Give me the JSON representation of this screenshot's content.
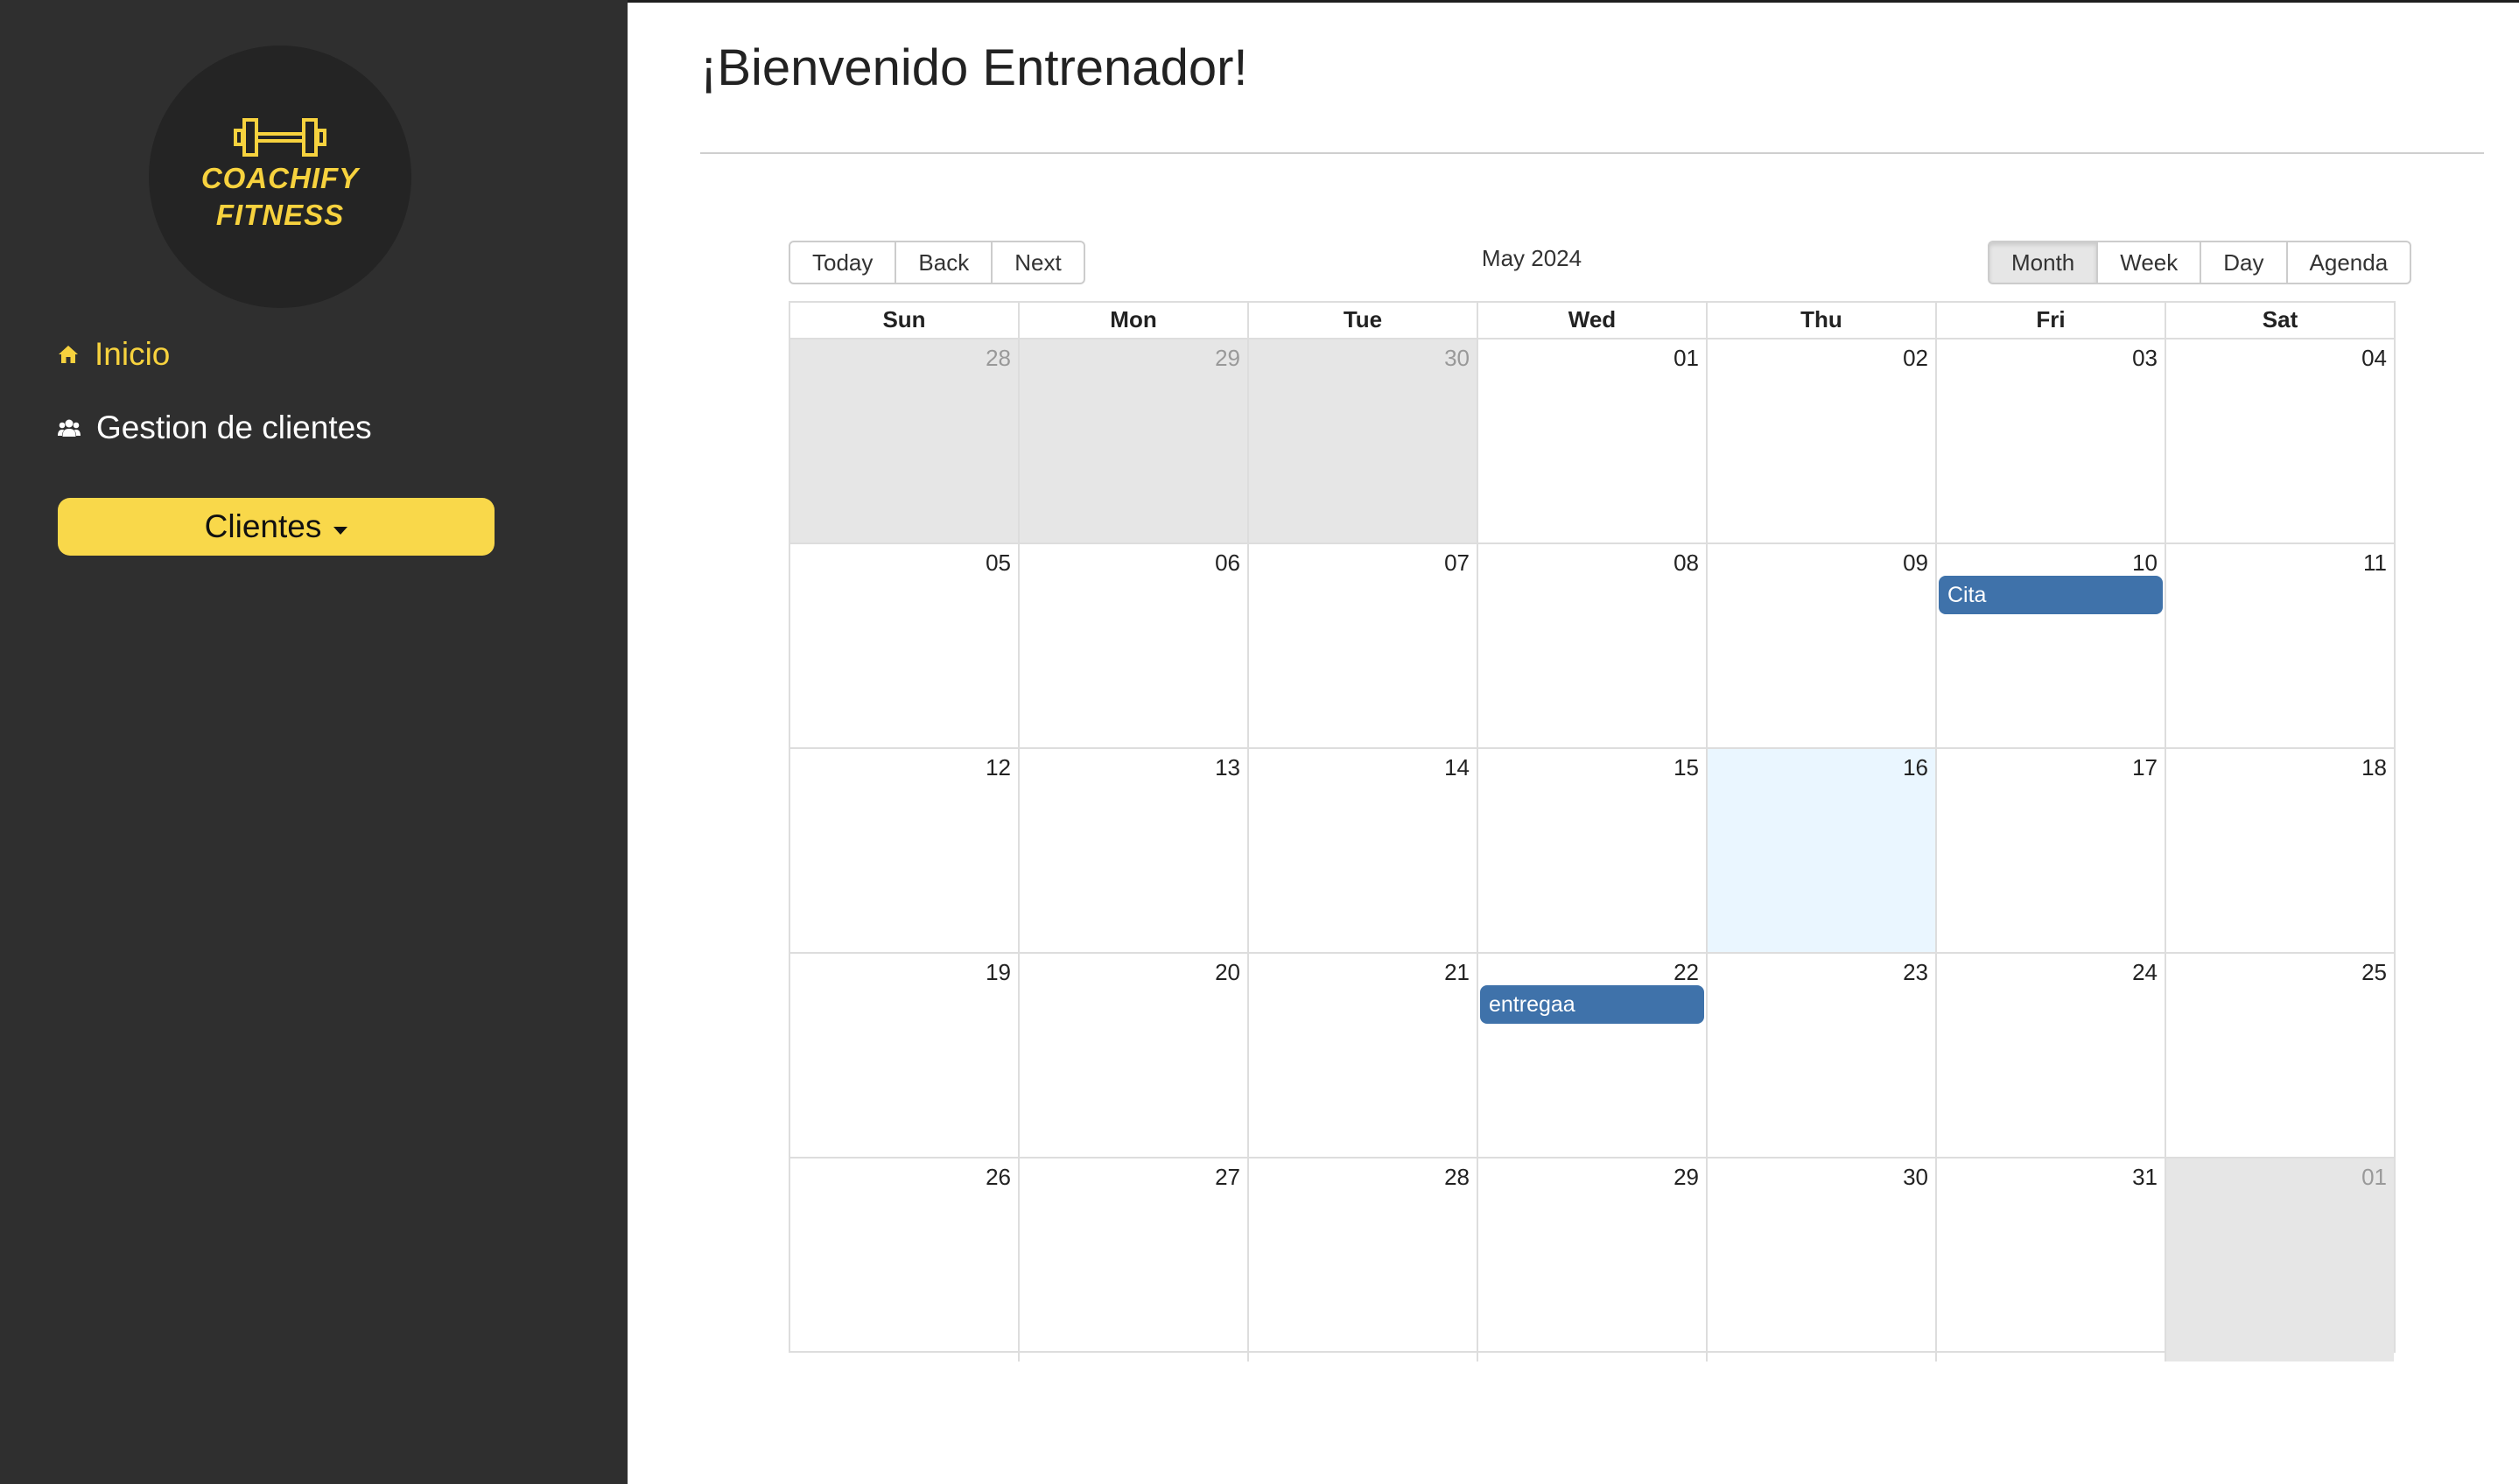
{
  "sidebar": {
    "logo_line1": "COACHIFY",
    "logo_line2": "FITNESS",
    "nav": [
      {
        "label": "Inicio",
        "icon": "home-icon",
        "active": true
      },
      {
        "label": "Gestion de clientes",
        "icon": "users-icon",
        "active": false
      }
    ],
    "clientes_button": "Clientes"
  },
  "main": {
    "title": "¡Bienvenido Entrenador!"
  },
  "calendar": {
    "nav_buttons": [
      "Today",
      "Back",
      "Next"
    ],
    "label": "May 2024",
    "views": [
      "Month",
      "Week",
      "Day",
      "Agenda"
    ],
    "active_view": "Month",
    "weekdays": [
      "Sun",
      "Mon",
      "Tue",
      "Wed",
      "Thu",
      "Fri",
      "Sat"
    ],
    "weeks": [
      [
        "28",
        "29",
        "30",
        "01",
        "02",
        "03",
        "04"
      ],
      [
        "05",
        "06",
        "07",
        "08",
        "09",
        "10",
        "11"
      ],
      [
        "12",
        "13",
        "14",
        "15",
        "16",
        "17",
        "18"
      ],
      [
        "19",
        "20",
        "21",
        "22",
        "23",
        "24",
        "25"
      ],
      [
        "26",
        "27",
        "28",
        "29",
        "30",
        "31",
        "01"
      ]
    ],
    "events": [
      {
        "title": "Cita",
        "week": 1,
        "day": 5
      },
      {
        "title": "entregaa",
        "week": 3,
        "day": 3
      }
    ],
    "today": {
      "week": 2,
      "day": 4
    }
  },
  "colors": {
    "sidebar_bg": "#2f2f2f",
    "accent": "#f7d23e",
    "event": "#3f72aa",
    "today_bg": "#eaf6ff",
    "off_range_bg": "#e6e6e6"
  }
}
